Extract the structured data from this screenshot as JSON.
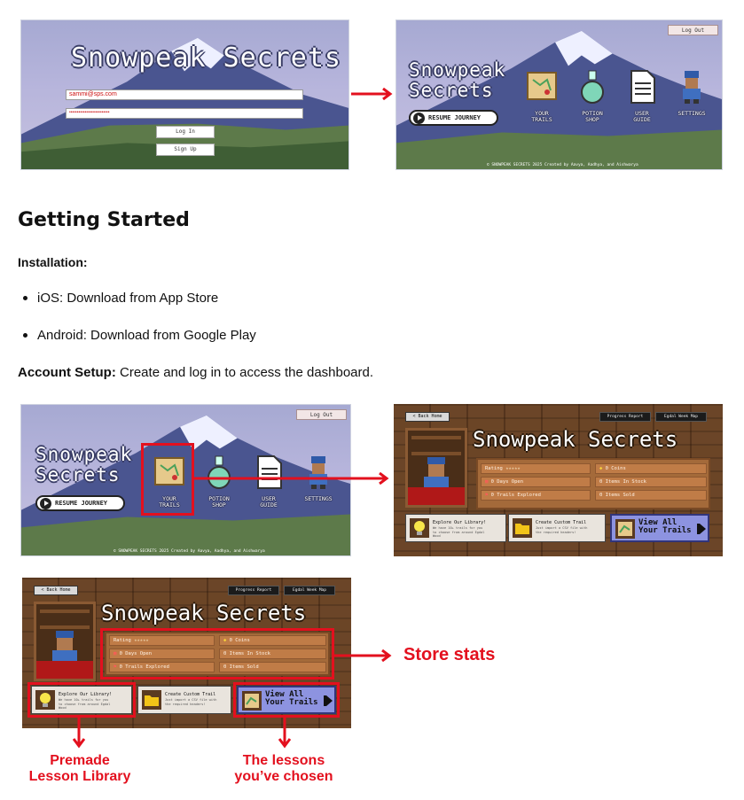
{
  "app_title": "Snowpeak Secrets",
  "app_title_lines": [
    "Snowpeak",
    "Secrets"
  ],
  "login": {
    "email": "sammi@sps.com",
    "password_mask": "••••••••••••••••••••••••••",
    "login_label": "Log In",
    "signup_label": "Sign Up"
  },
  "home": {
    "logout_label": "Log Out",
    "resume_label": "RESUME JOURNEY",
    "menu": [
      {
        "label_lines": [
          "YOUR",
          "TRAILS"
        ],
        "icon": "map-icon"
      },
      {
        "label_lines": [
          "POTION",
          "SHOP"
        ],
        "icon": "potion-icon"
      },
      {
        "label_lines": [
          "USER",
          "GUIDE"
        ],
        "icon": "document-icon"
      },
      {
        "label_lines": [
          "SETTINGS",
          ""
        ],
        "icon": "character-icon"
      }
    ],
    "footer": "© SNOWPEAK SECRETS 2025 Created by Aavya, Aadhya, and Aishwarya"
  },
  "doc": {
    "heading": "Getting Started",
    "installation_label": "Installation:",
    "bullets": [
      "iOS: Download from App Store",
      "Android: Download from Google Play"
    ],
    "account_label": "Account Setup:",
    "account_text": " Create and log in to access the dashboard."
  },
  "store": {
    "back_label": "< Back Home",
    "progress_label": "Progress Report",
    "map_label": "Egdal Week Map",
    "rating_label": "Rating",
    "stars": "★★★★★",
    "stats": [
      "0 Coins",
      "0 Days Open",
      "0 Items In Stock",
      "0 Trails Explored",
      "0 Items Sold"
    ],
    "cards": [
      {
        "title": "Explore Our Library!",
        "desc": "We have 10+ trails for you to choose from around Egdal Wood"
      },
      {
        "title": "Create Custom Trail",
        "desc": "Just import a CSV file with the required headers!"
      }
    ],
    "view_all_lines": [
      "View All",
      "Your Trails"
    ]
  },
  "annotations": {
    "store_stats": "Store stats",
    "premade_lines": [
      "Premade",
      "Lesson Library"
    ],
    "chosen_lines": [
      "The lessons",
      "you’ve chosen"
    ]
  },
  "colors": {
    "accent_red": "#e3101e",
    "sky": "#b7b5dc",
    "wood": "#6b4528",
    "view_all": "#8d93e0"
  }
}
